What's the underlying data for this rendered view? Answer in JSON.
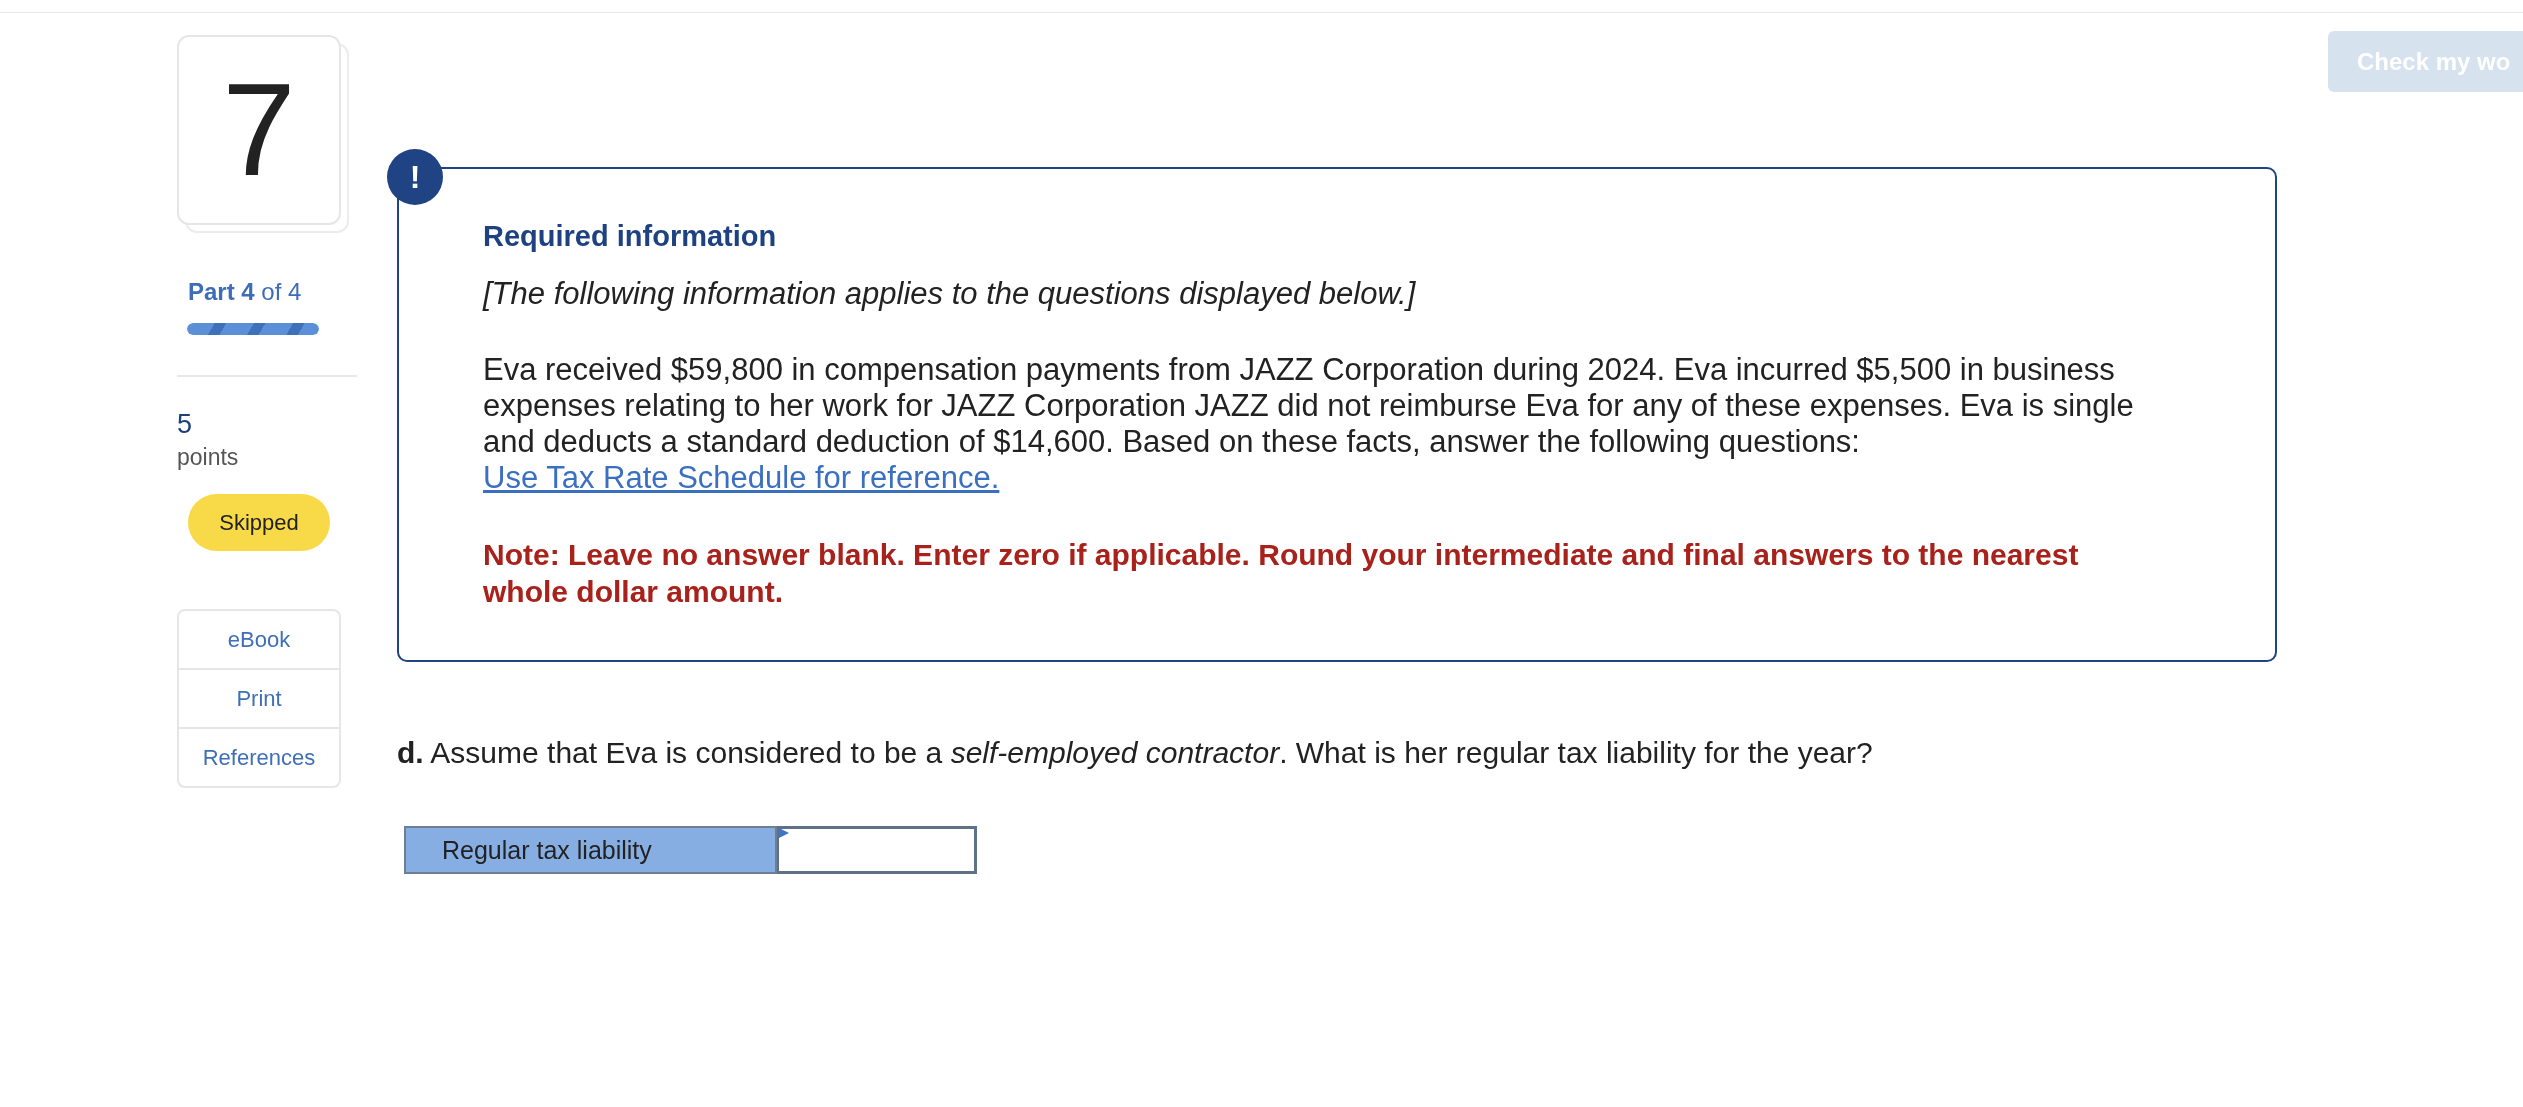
{
  "header": {
    "check_button": {
      "label": "Check my wo",
      "disabled": true
    }
  },
  "sidebar": {
    "question_number": "7",
    "part": "**Part 4** of 4",
    "progress": {
      "level": 1
    },
    "points_value": "5",
    "points_label": "points",
    "status_badge": "Skipped",
    "tools": [
      {
        "label": "eBook"
      },
      {
        "label": "Print"
      },
      {
        "label": "References"
      }
    ]
  },
  "info_box": {
    "icon_text": "!",
    "title": "Required information",
    "intro": "[The following information applies to the questions displayed below.]",
    "body": "Eva received $59,800 in compensation payments from JAZZ Corporation during 2024. Eva incurred $5,500 in business expenses relating to her work for JAZZ Corporation JAZZ did not reimburse Eva for any of these expenses. Eva is single and deducts a standard deduction of $14,600. Based on these facts, answer the following questions:",
    "link": "Use Tax Rate Schedule for reference.",
    "note": "Note: Leave no answer blank. Enter zero if applicable. Round your intermediate and final answers to the nearest whole dollar amount."
  },
  "question": {
    "text": "**d.** Assume that Eva is considered to be a *self-employed contractor*. What is her regular tax liability for the year?",
    "answer_table": {
      "rows": [
        {
          "label": "Regular tax liability"
        }
      ]
    }
  }
}
